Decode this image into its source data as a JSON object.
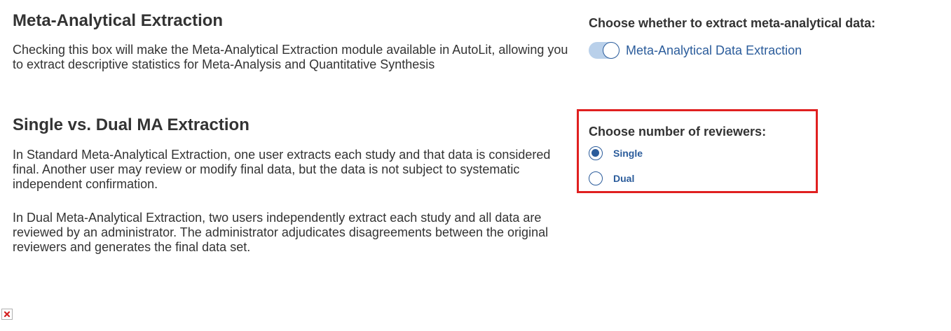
{
  "meta_analytical": {
    "title": "Meta-Analytical Extraction",
    "description": "Checking this box will make the Meta-Analytical Extraction module available in AutoLit, allowing you to extract descriptive statistics for Meta-Analysis and Quantitative Synthesis",
    "choose_heading": "Choose whether to extract meta-analytical data:",
    "toggle": {
      "label": "Meta-Analytical Data Extraction",
      "state": "on"
    }
  },
  "single_vs_dual": {
    "title": "Single vs. Dual MA Extraction",
    "paragraph_1": "In Standard Meta-Analytical Extraction, one user extracts each study and that data is considered final. Another user may review or modify final data, but the data is not subject to systematic independent confirmation.",
    "paragraph_2": "In Dual Meta-Analytical Extraction, two users independently extract each study and all data are reviewed by an administrator. The administrator adjudicates disagreements between the original reviewers and generates the final data set.",
    "reviewers_heading": "Choose number of reviewers:",
    "options": [
      {
        "label": "Single",
        "selected": true
      },
      {
        "label": "Dual",
        "selected": false
      }
    ]
  },
  "colors": {
    "accent": "#2b5c9b",
    "highlight_border": "#e02020",
    "toggle_track": "#b9d0ea",
    "text": "#333333"
  },
  "icons": {
    "broken_image": "broken-image-icon"
  }
}
